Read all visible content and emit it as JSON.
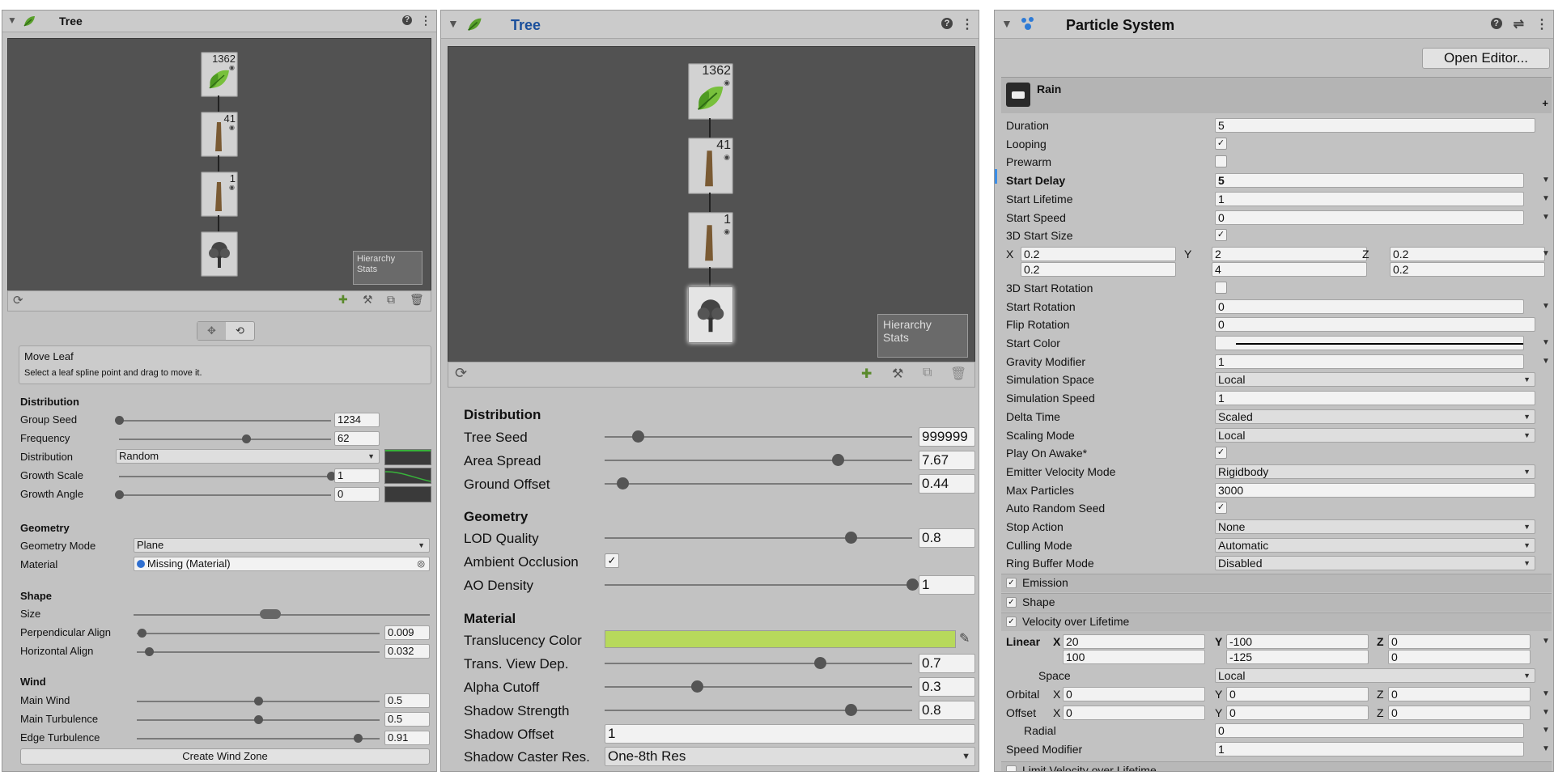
{
  "panel1": {
    "title": "Tree",
    "nodes": [
      {
        "count": "1362"
      },
      {
        "count": "41"
      },
      {
        "count": "1"
      },
      {
        "count": ""
      }
    ],
    "hierarchy_stats": "Hierarchy\nStats",
    "tool_title": "Move Leaf",
    "tool_desc": "Select a leaf spline point and drag to move it.",
    "distribution": {
      "header": "Distribution",
      "group_seed": {
        "label": "Group Seed",
        "value": "1234",
        "level": 0.0
      },
      "frequency": {
        "label": "Frequency",
        "value": "62",
        "level": 0.6
      },
      "distribution": {
        "label": "Distribution",
        "value": "Random"
      },
      "growth_scale": {
        "label": "Growth Scale",
        "value": "1",
        "level": 1.0
      },
      "growth_angle": {
        "label": "Growth Angle",
        "value": "0",
        "level": 0.0
      }
    },
    "geometry": {
      "header": "Geometry",
      "geometry_mode": {
        "label": "Geometry Mode",
        "value": "Plane"
      },
      "material": {
        "label": "Material",
        "value": "Missing (Material)"
      }
    },
    "shape": {
      "header": "Shape",
      "size": {
        "label": "Size"
      },
      "perpendicular_align": {
        "label": "Perpendicular Align",
        "value": "0.009",
        "level": 0.02
      },
      "horizontal_align": {
        "label": "Horizontal Align",
        "value": "0.032",
        "level": 0.05
      }
    },
    "wind": {
      "header": "Wind",
      "main_wind": {
        "label": "Main Wind",
        "value": "0.5",
        "level": 0.5
      },
      "main_turbulence": {
        "label": "Main Turbulence",
        "value": "0.5",
        "level": 0.5
      },
      "edge_turbulence": {
        "label": "Edge Turbulence",
        "value": "0.91",
        "level": 0.91
      },
      "create_button": "Create Wind Zone"
    }
  },
  "panel2": {
    "title": "Tree",
    "nodes": [
      {
        "count": "1362"
      },
      {
        "count": "41"
      },
      {
        "count": "1"
      },
      {
        "count": ""
      }
    ],
    "hierarchy_stats": "Hierarchy\nStats",
    "distribution": {
      "header": "Distribution",
      "tree_seed": {
        "label": "Tree Seed",
        "value": "999999",
        "level": 0.11
      },
      "area_spread": {
        "label": "Area Spread",
        "value": "7.67",
        "level": 0.76
      },
      "ground_offset": {
        "label": "Ground Offset",
        "value": "0.44",
        "level": 0.06
      }
    },
    "geometry": {
      "header": "Geometry",
      "lod_quality": {
        "label": "LOD Quality",
        "value": "0.8",
        "level": 0.8
      },
      "ambient_occlusion": {
        "label": "Ambient Occlusion",
        "checked": true
      },
      "ao_density": {
        "label": "AO Density",
        "value": "1",
        "level": 1.0
      }
    },
    "material": {
      "header": "Material",
      "translucency_color": {
        "label": "Translucency Color",
        "color": "#b7d95b"
      },
      "trans_view_dep": {
        "label": "Trans. View Dep.",
        "value": "0.7",
        "level": 0.7
      },
      "alpha_cutoff": {
        "label": "Alpha Cutoff",
        "value": "0.3",
        "level": 0.3
      },
      "shadow_strength": {
        "label": "Shadow Strength",
        "value": "0.8",
        "level": 0.8
      },
      "shadow_offset": {
        "label": "Shadow Offset",
        "value": "1"
      },
      "shadow_caster_res": {
        "label": "Shadow Caster Res.",
        "value": "One-8th Res"
      }
    }
  },
  "panel3": {
    "title": "Particle System",
    "open_editor": "Open Editor...",
    "system_name": "Rain",
    "rows": [
      {
        "label": "Duration",
        "type": "field",
        "value": "5"
      },
      {
        "label": "Looping",
        "type": "check",
        "checked": true
      },
      {
        "label": "Prewarm",
        "type": "check",
        "checked": false
      },
      {
        "label": "Start Delay",
        "type": "field",
        "value": "5",
        "bold": true,
        "arrow": true
      },
      {
        "label": "Start Lifetime",
        "type": "field",
        "value": "1",
        "arrow": true
      },
      {
        "label": "Start Speed",
        "type": "field",
        "value": "0",
        "arrow": true
      },
      {
        "label": "3D Start Size",
        "type": "check",
        "checked": true
      }
    ],
    "size_xyz": {
      "x": "0.2",
      "y": "2",
      "z": "0.2",
      "x2": "0.2",
      "y2": "4",
      "z2": "0.2",
      "lx": "X",
      "ly": "Y",
      "lz": "Z"
    },
    "rows2": [
      {
        "label": "3D Start Rotation",
        "type": "check",
        "checked": false
      },
      {
        "label": "Start Rotation",
        "type": "field",
        "value": "0",
        "arrow": true
      },
      {
        "label": "Flip Rotation",
        "type": "field",
        "value": "0"
      },
      {
        "label": "Start Color",
        "type": "color",
        "arrow": true
      },
      {
        "label": "Gravity Modifier",
        "type": "field",
        "value": "1",
        "arrow": true
      },
      {
        "label": "Simulation Space",
        "type": "dropdown",
        "value": "Local"
      },
      {
        "label": "Simulation Speed",
        "type": "field",
        "value": "1"
      },
      {
        "label": "Delta Time",
        "type": "dropdown",
        "value": "Scaled"
      },
      {
        "label": "Scaling Mode",
        "type": "dropdown",
        "value": "Local"
      },
      {
        "label": "Play On Awake*",
        "type": "check",
        "checked": true
      },
      {
        "label": "Emitter Velocity Mode",
        "type": "dropdown",
        "value": "Rigidbody"
      },
      {
        "label": "Max Particles",
        "type": "field",
        "value": "3000"
      },
      {
        "label": "Auto Random Seed",
        "type": "check",
        "checked": true
      },
      {
        "label": "Stop Action",
        "type": "dropdown",
        "value": "None"
      },
      {
        "label": "Culling Mode",
        "type": "dropdown",
        "value": "Automatic"
      },
      {
        "label": "Ring Buffer Mode",
        "type": "dropdown",
        "value": "Disabled"
      }
    ],
    "modules": [
      {
        "label": "Emission",
        "checked": true
      },
      {
        "label": "Shape",
        "checked": true
      },
      {
        "label": "Velocity over Lifetime",
        "checked": true
      }
    ],
    "velocity": {
      "linear_label": "Linear",
      "lx": "X",
      "ly": "Y",
      "lz": "Z",
      "x1": "20",
      "y1": "-100",
      "z1": "0",
      "x2": "100",
      "y2": "-125",
      "z2": "0",
      "space_label": "Space",
      "space_value": "Local",
      "orbital_label": "Orbital",
      "ox": "0",
      "oy": "0",
      "oz": "0",
      "offset_label": "Offset",
      "fx": "0",
      "fy": "0",
      "fz": "0",
      "radial_label": "Radial",
      "radial_value": "0",
      "speed_modifier_label": "Speed Modifier",
      "speed_modifier_value": "1"
    },
    "last_module": "Limit Velocity over Lifetime"
  }
}
